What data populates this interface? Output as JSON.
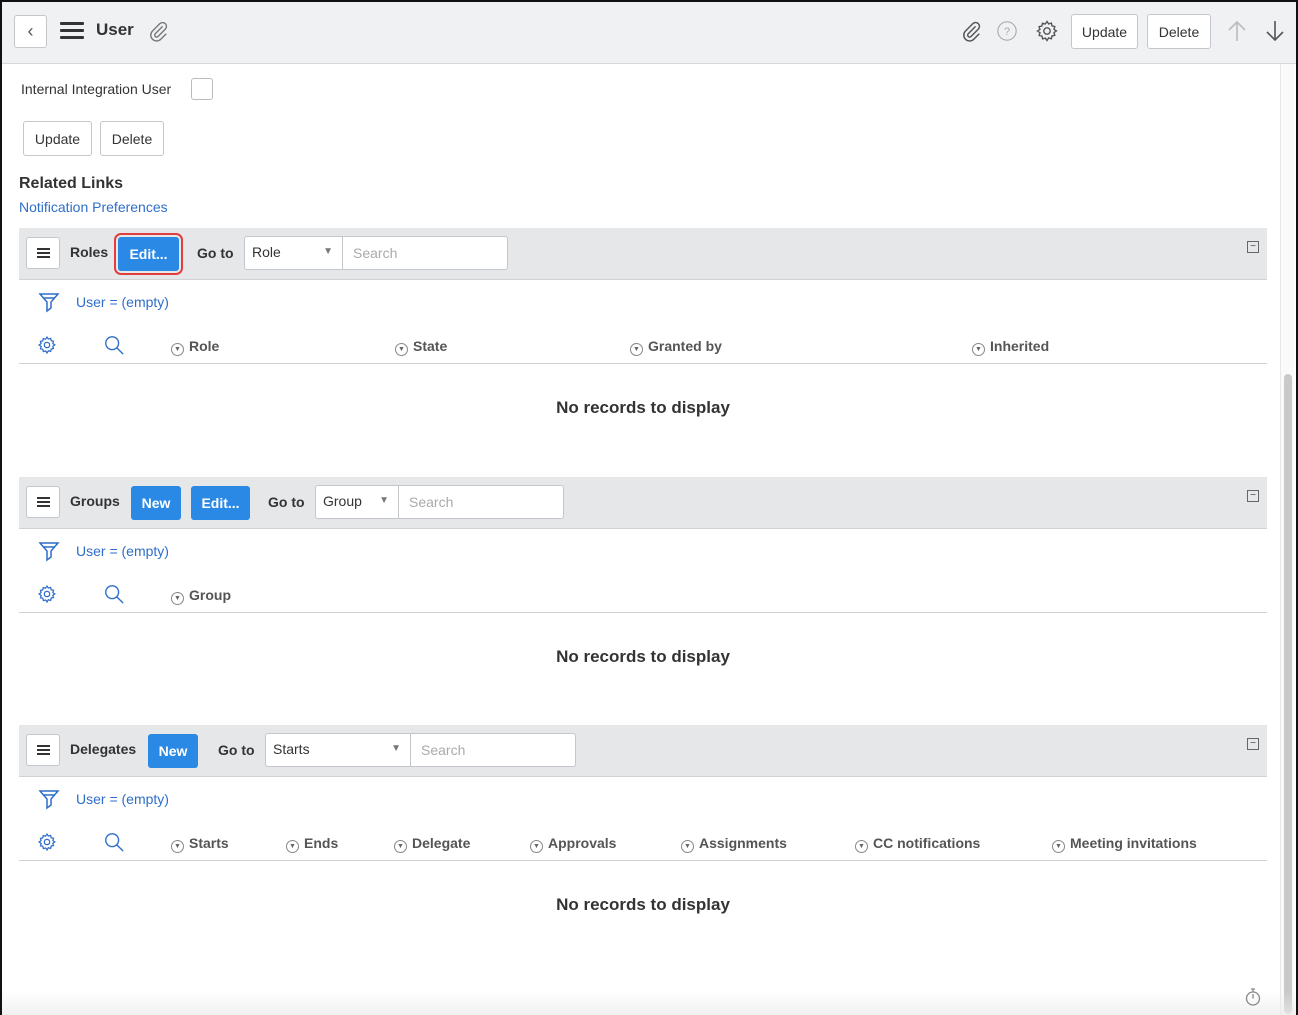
{
  "header": {
    "title": "User",
    "update_label": "Update",
    "delete_label": "Delete"
  },
  "form": {
    "internal_integration_label": "Internal Integration User",
    "update_label": "Update",
    "delete_label": "Delete"
  },
  "related_links": {
    "title": "Related Links",
    "notification_link": "Notification Preferences"
  },
  "roles": {
    "title": "Roles",
    "edit_label": "Edit...",
    "goto_label": "Go to",
    "goto_value": "Role",
    "search_placeholder": "Search",
    "filter": "User = (empty)",
    "columns": [
      "Role",
      "State",
      "Granted by",
      "Inherited"
    ],
    "empty_message": "No records to display"
  },
  "groups": {
    "title": "Groups",
    "new_label": "New",
    "edit_label": "Edit...",
    "goto_label": "Go to",
    "goto_value": "Group",
    "search_placeholder": "Search",
    "filter": "User = (empty)",
    "columns": [
      "Group"
    ],
    "empty_message": "No records to display"
  },
  "delegates": {
    "title": "Delegates",
    "new_label": "New",
    "goto_label": "Go to",
    "goto_value": "Starts",
    "search_placeholder": "Search",
    "filter": "User = (empty)",
    "columns": [
      "Starts",
      "Ends",
      "Delegate",
      "Approvals",
      "Assignments",
      "CC notifications",
      "Meeting invitations"
    ],
    "empty_message": "No records to display"
  },
  "colors": {
    "primary_button": "#2b89e6",
    "link": "#2e6ec9",
    "highlight_outline": "#e23d3d",
    "header_bg": "#f0f1f3",
    "list_bar_bg": "#e6e7e9"
  },
  "icons": [
    "chevron-left-icon",
    "hamburger-menu-icon",
    "paperclip-icon",
    "help-icon",
    "gear-icon",
    "arrow-up-icon",
    "arrow-down-icon",
    "filter-funnel-icon",
    "search-icon",
    "collapse-icon",
    "timer-icon"
  ]
}
